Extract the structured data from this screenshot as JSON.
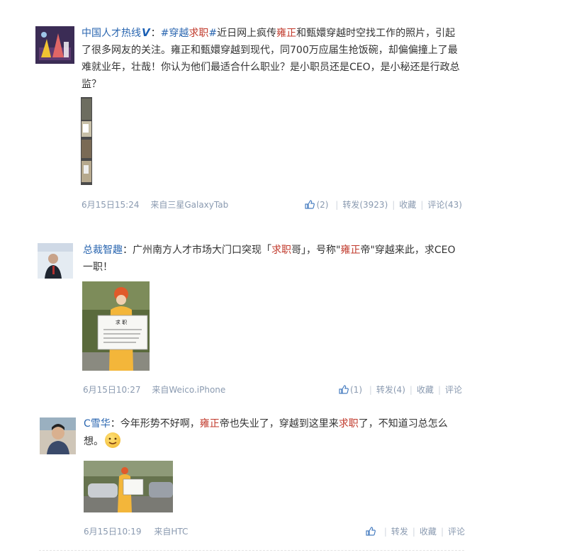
{
  "posts": [
    {
      "nickname": "中国人才热线",
      "verified_mark": "V",
      "colon": "：",
      "hashtag_pre": "#穿越",
      "hashtag_red": "求职",
      "hashtag_post": "#",
      "text_a": "近日网上疯传",
      "red_name": "雍正",
      "text_b": "和甄嬛穿越时空找工作的照片，引起了很多网友的关注。雍正和甄嬛穿越到现代，同700万应届生抢饭碗，却偏偏撞上了最难就业年，壮哉！你认为他们最适合什么职业？是小职员还是CEO，是小秘还是行政总监？",
      "time": "6月15日15:24",
      "source_prefix": "来自",
      "source": "三星GalaxyTab",
      "like_count": "(2)",
      "repost": "转发(3923)",
      "favorite": "收藏",
      "comment": "评论(43)"
    },
    {
      "nickname": "总裁智趣",
      "colon": "：",
      "text_a": "广州南方人才市场大门口突现「",
      "red_a": "求职",
      "text_b": "哥」，号称\"",
      "red_b": "雍正",
      "text_c": "帝\"穿越来此，求CEO一职！",
      "photo_sign_title": "求 职",
      "time": "6月15日10:27",
      "source_prefix": "来自",
      "source": "Weico.iPhone",
      "like_count": "(1)",
      "repost": "转发(4)",
      "favorite": "收藏",
      "comment": "评论"
    },
    {
      "nickname": "C雪华",
      "colon": "：",
      "text_a": "今年形势不好啊，",
      "red_a": "雍正",
      "text_b": "帝也失业了，穿越到这里来",
      "red_b": "求职",
      "text_c": "了，不知道习总怎么想。",
      "time": "6月15日10:19",
      "source_prefix": "来自",
      "source": "HTC",
      "repost": "转发",
      "favorite": "收藏",
      "comment": "评论"
    }
  ],
  "colors": {
    "link": "#2a66b0",
    "highlight": "#c0392b",
    "meta": "#8a9ab0"
  },
  "icons": [
    "thumb-up-icon",
    "grin-emoji-icon",
    "verified-icon"
  ]
}
